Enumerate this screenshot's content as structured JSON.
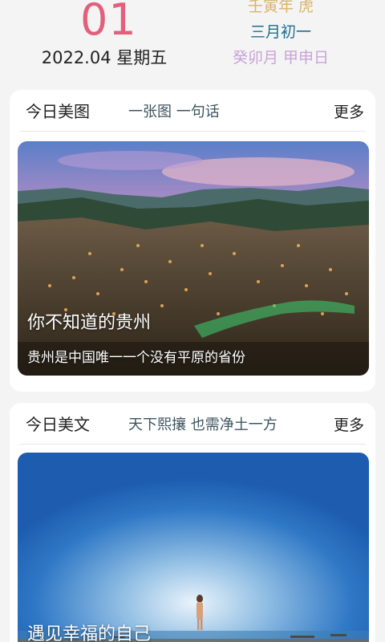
{
  "calendar": {
    "day": "01",
    "date_line": "2022.04 星期五",
    "lunar_year": "壬寅年 虎",
    "lunar_date": "三月初一",
    "ganzhi": "癸卯月 甲申日"
  },
  "colors": {
    "day": "#e2607a",
    "lunar_year": "#d9b36a",
    "lunar_date": "#1e6f8a",
    "ganzhi": "#c9a4d6"
  },
  "photo_card": {
    "title": "今日美图",
    "subtitle": "一张图 一句话",
    "more": "更多",
    "image_title": "你不知道的贵州",
    "image_desc": "贵州是中国唯一一个没有平原的省份"
  },
  "article_card": {
    "title": "今日美文",
    "subtitle": "天下熙攘 也需净土一方",
    "more": "更多",
    "image_title": "遇见幸福的自己"
  }
}
